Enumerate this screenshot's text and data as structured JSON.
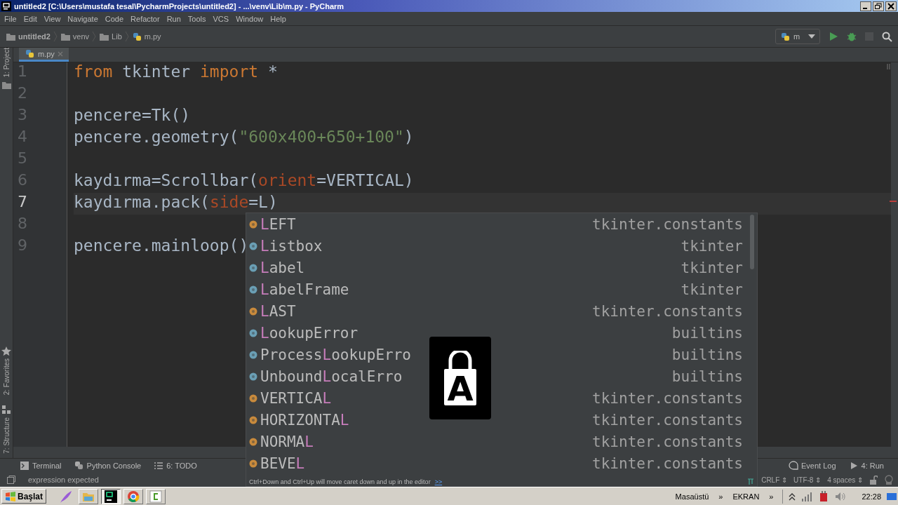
{
  "window": {
    "title": "untitled2 [C:\\Users\\mustafa tesal\\PycharmProjects\\untitled2] - ...\\venv\\Lib\\m.py - PyCharm"
  },
  "menu": [
    "File",
    "Edit",
    "View",
    "Navigate",
    "Code",
    "Refactor",
    "Run",
    "Tools",
    "VCS",
    "Window",
    "Help"
  ],
  "breadcrumbs": [
    {
      "label": "untitled2",
      "kind": "folder"
    },
    {
      "label": "venv",
      "kind": "folder"
    },
    {
      "label": "Lib",
      "kind": "folder"
    },
    {
      "label": "m.py",
      "kind": "file"
    }
  ],
  "run_config": {
    "label": "m"
  },
  "editor_tabs": [
    {
      "label": "m.py",
      "selected": true
    }
  ],
  "left_strip": [
    "1: Project",
    "2: Favorites",
    "7: Structure"
  ],
  "code": [
    {
      "number": "1",
      "current": false,
      "tokens": [
        {
          "text": "from",
          "kind": "keyword"
        },
        {
          "text": " tkinter ",
          "kind": "plain"
        },
        {
          "text": "import",
          "kind": "keyword"
        },
        {
          "text": " *",
          "kind": "plain"
        }
      ]
    },
    {
      "number": "2",
      "current": false
    },
    {
      "number": "3",
      "current": false,
      "tokens": [
        {
          "text": "pencere=Tk()",
          "kind": "plain"
        }
      ]
    },
    {
      "number": "4",
      "current": false,
      "tokens": [
        {
          "text": "pencere.geometry(",
          "kind": "plain"
        },
        {
          "text": "\"600x400+650+100\"",
          "kind": "string"
        },
        {
          "text": ")",
          "kind": "plain"
        }
      ]
    },
    {
      "number": "5",
      "current": false
    },
    {
      "number": "6",
      "current": false,
      "tokens": [
        {
          "text": "kaydırma=Scrollbar(",
          "kind": "plain"
        },
        {
          "text": "orient",
          "kind": "param"
        },
        {
          "text": "=VERTICAL)",
          "kind": "plain"
        }
      ]
    },
    {
      "number": "7",
      "current": true,
      "tokens": [
        {
          "text": "kaydırma.pack(",
          "kind": "plain"
        },
        {
          "text": "side",
          "kind": "param"
        },
        {
          "text": "=L",
          "kind": "plain"
        },
        {
          "text": ")",
          "kind": "plain"
        }
      ]
    },
    {
      "number": "8",
      "current": false
    },
    {
      "number": "9",
      "current": false,
      "tokens": [
        {
          "text": "pencere.mainloop()",
          "kind": "plain"
        }
      ]
    }
  ],
  "completion": {
    "items": [
      {
        "kind": "constant",
        "parts": [
          {
            "text": "L",
            "match": true
          },
          {
            "text": "EFT",
            "match": false
          }
        ],
        "source": "tkinter.constants"
      },
      {
        "kind": "class",
        "parts": [
          {
            "text": "L",
            "match": true
          },
          {
            "text": "istbox",
            "match": false
          }
        ],
        "source": "tkinter"
      },
      {
        "kind": "class",
        "parts": [
          {
            "text": "L",
            "match": true
          },
          {
            "text": "abel",
            "match": false
          }
        ],
        "source": "tkinter"
      },
      {
        "kind": "class",
        "parts": [
          {
            "text": "L",
            "match": true
          },
          {
            "text": "abelFrame",
            "match": false
          }
        ],
        "source": "tkinter"
      },
      {
        "kind": "constant",
        "parts": [
          {
            "text": "L",
            "match": true
          },
          {
            "text": "AST",
            "match": false
          }
        ],
        "source": "tkinter.constants"
      },
      {
        "kind": "class",
        "parts": [
          {
            "text": "L",
            "match": true
          },
          {
            "text": "ookupError",
            "match": false
          }
        ],
        "source": "builtins"
      },
      {
        "kind": "class",
        "parts": [
          {
            "text": "Process",
            "match": false
          },
          {
            "text": "L",
            "match": true
          },
          {
            "text": "ookupErro",
            "match": false
          }
        ],
        "source": "builtins"
      },
      {
        "kind": "class",
        "parts": [
          {
            "text": "Unbound",
            "match": false
          },
          {
            "text": "L",
            "match": true
          },
          {
            "text": "ocalErro",
            "match": false
          }
        ],
        "source": "builtins"
      },
      {
        "kind": "constant",
        "parts": [
          {
            "text": "VERTICA",
            "match": false
          },
          {
            "text": "L",
            "match": true
          }
        ],
        "source": "tkinter.constants"
      },
      {
        "kind": "constant",
        "parts": [
          {
            "text": "HORIZONTA",
            "match": false
          },
          {
            "text": "L",
            "match": true
          }
        ],
        "source": "tkinter.constants"
      },
      {
        "kind": "constant",
        "parts": [
          {
            "text": "NORMA",
            "match": false
          },
          {
            "text": "L",
            "match": true
          }
        ],
        "source": "tkinter.constants"
      },
      {
        "kind": "constant",
        "parts": [
          {
            "text": "BEVE",
            "match": false
          },
          {
            "text": "L",
            "match": true
          }
        ],
        "source": "tkinter.constants"
      }
    ],
    "hint": "Ctrl+Down and Ctrl+Up will move caret down and up in the editor",
    "hint_link": ">>"
  },
  "caps_lock_overlay": {
    "letter": "A"
  },
  "tool_windows_left": [
    {
      "label": "Terminal",
      "kind": "terminal"
    },
    {
      "label": "Python Console",
      "kind": "python"
    },
    {
      "label": "6: TODO",
      "kind": "todo"
    }
  ],
  "tool_windows_right": [
    {
      "label": "Event Log",
      "kind": "log"
    },
    {
      "label": "4: Run",
      "kind": "run"
    }
  ],
  "status_bar": {
    "message": "expression expected",
    "items": [
      "CRLF ⇕",
      "UTF-8 ⇕",
      "4 spaces ⇕"
    ]
  },
  "taskbar": {
    "start": "Başlat",
    "toolbars": [
      "Masaüstü",
      "»",
      "EKRAN",
      "»"
    ],
    "clock": "22:28"
  }
}
